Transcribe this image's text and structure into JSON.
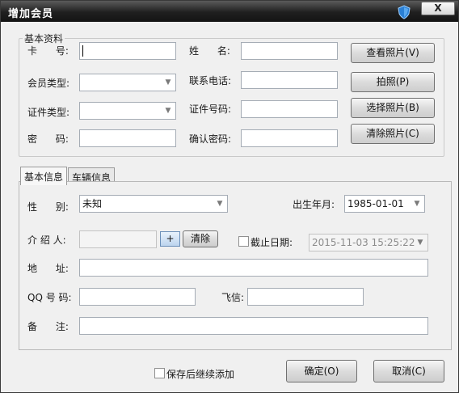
{
  "window": {
    "title": "增加会员",
    "close_label": "X"
  },
  "basic_info": {
    "legend": "基本资料",
    "card_no_label": "卡      号:",
    "card_no_value": "",
    "name_label": "姓      名:",
    "name_value": "",
    "member_type_label": "会员类型:",
    "member_type_value": "",
    "phone_label": "联系电话:",
    "phone_value": "",
    "id_type_label": "证件类型:",
    "id_type_value": "",
    "id_no_label": "证件号码:",
    "id_no_value": "",
    "password_label": "密      码:",
    "password_value": "",
    "confirm_password_label": "确认密码:",
    "confirm_password_value": ""
  },
  "photo_buttons": {
    "view": "查看照片(V)",
    "take": "拍照(P)",
    "select": "选择照片(B)",
    "clear": "清除照片(C)"
  },
  "tabs": [
    {
      "label": "基本信息",
      "active": true
    },
    {
      "label": "车辆信息",
      "active": false
    }
  ],
  "detail": {
    "gender_label": "性      别:",
    "gender_value": "未知",
    "birth_label": "出生年月:",
    "birth_value": "1985-01-01",
    "referrer_label": "介 绍 人:",
    "referrer_value": "",
    "referrer_add": "+",
    "referrer_clear": "清除",
    "expiry_label": "截止日期:",
    "expiry_checked": false,
    "expiry_value": "2015-11-03 15:25:22",
    "address_label": "地      址:",
    "address_value": "",
    "qq_label": "QQ 号 码:",
    "qq_value": "",
    "fetion_label": "飞信:",
    "fetion_value": "",
    "remark_label": "备      注:",
    "remark_value": ""
  },
  "footer": {
    "continue_label": "保存后继续添加",
    "continue_checked": false,
    "ok": "确定(O)",
    "cancel": "取消(C)"
  },
  "icons": {
    "title_icon": "shield-icon",
    "dropdown": "chevron-down-icon"
  },
  "colors": {
    "titlebar": "#1f1f1f",
    "window_bg": "#f0f0f0",
    "accent": "#2a7fd4"
  }
}
